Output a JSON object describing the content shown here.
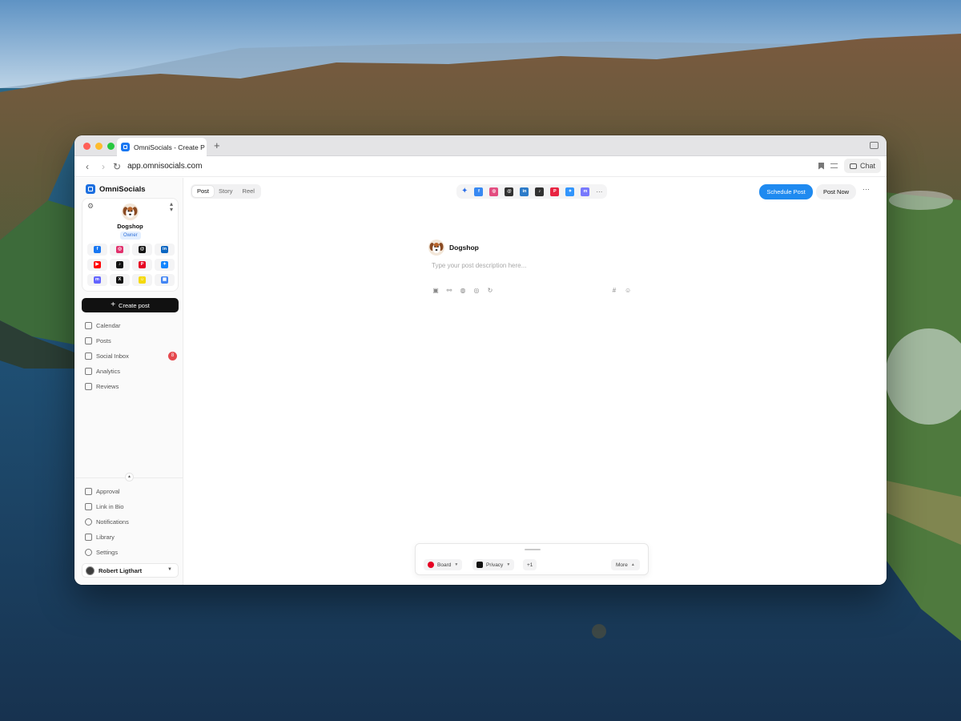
{
  "browser": {
    "tab_title": "OmniSocials - Create P",
    "new_tab": "+",
    "url": "app.omnisocials.com",
    "chat_label": "Chat"
  },
  "sidebar": {
    "brand": "OmniSocials",
    "profile": {
      "name": "Dogshop",
      "role": "Owner"
    },
    "channels": [
      {
        "icon": "facebook-icon",
        "color": "#1877f2",
        "glyph": "f"
      },
      {
        "icon": "instagram-icon",
        "color": "#e1306c",
        "glyph": "◎"
      },
      {
        "icon": "threads-icon",
        "color": "#111111",
        "glyph": "@"
      },
      {
        "icon": "linkedin-icon",
        "color": "#0a66c2",
        "glyph": "in"
      },
      {
        "icon": "youtube-icon",
        "color": "#ff0000",
        "glyph": "▶"
      },
      {
        "icon": "tiktok-icon",
        "color": "#111111",
        "glyph": "♪"
      },
      {
        "icon": "pinterest-icon",
        "color": "#e60023",
        "glyph": "P"
      },
      {
        "icon": "bluesky-icon",
        "color": "#1185fe",
        "glyph": "✦"
      },
      {
        "icon": "mastodon-icon",
        "color": "#6364ff",
        "glyph": "m"
      },
      {
        "icon": "x-icon",
        "color": "#111111",
        "glyph": "X"
      },
      {
        "icon": "snapchat-icon",
        "color": "#f5d90a",
        "glyph": "☺"
      },
      {
        "icon": "google-business-icon",
        "color": "#4285f4",
        "glyph": "▦"
      }
    ],
    "create_label": "Create post",
    "nav": [
      {
        "label": "Calendar",
        "icon": "calendar-icon"
      },
      {
        "label": "Posts",
        "icon": "image-icon"
      },
      {
        "label": "Social Inbox",
        "icon": "inbox-icon",
        "badge": "8"
      },
      {
        "label": "Analytics",
        "icon": "chart-icon"
      },
      {
        "label": "Reviews",
        "icon": "star-icon"
      }
    ],
    "nav_bottom": [
      {
        "label": "Approval",
        "icon": "check-square-icon"
      },
      {
        "label": "Link in Bio",
        "icon": "link-icon"
      },
      {
        "label": "Notifications",
        "icon": "bell-icon"
      },
      {
        "label": "Library",
        "icon": "folder-icon"
      },
      {
        "label": "Settings",
        "icon": "gear-icon"
      }
    ],
    "user": "Robert Ligthart"
  },
  "editor": {
    "type_tabs": [
      "Post",
      "Story",
      "Reel"
    ],
    "active_type": "Post",
    "channel_bar": [
      {
        "icon": "facebook-icon",
        "color": "#1877f2",
        "glyph": "f"
      },
      {
        "icon": "instagram-icon",
        "color": "#e1306c",
        "glyph": "◎"
      },
      {
        "icon": "threads-icon",
        "color": "#111111",
        "glyph": "@"
      },
      {
        "icon": "linkedin-icon",
        "color": "#0a66c2",
        "glyph": "in"
      },
      {
        "icon": "tiktok-icon",
        "color": "#111111",
        "glyph": "♪"
      },
      {
        "icon": "pinterest-icon",
        "color": "#e60023",
        "glyph": "P"
      },
      {
        "icon": "bluesky-icon",
        "color": "#1185fe",
        "glyph": "✦"
      },
      {
        "icon": "mastodon-icon",
        "color": "#6364ff",
        "glyph": "m"
      }
    ],
    "channel_more": "···",
    "schedule_label": "Schedule Post",
    "post_now_label": "Post Now",
    "more_actions": "···",
    "account_name": "Dogshop",
    "placeholder": "Type your post description here...",
    "options": {
      "board_label": "Board",
      "privacy_label": "Privacy",
      "extra_count": "+1",
      "more_label": "More"
    }
  }
}
